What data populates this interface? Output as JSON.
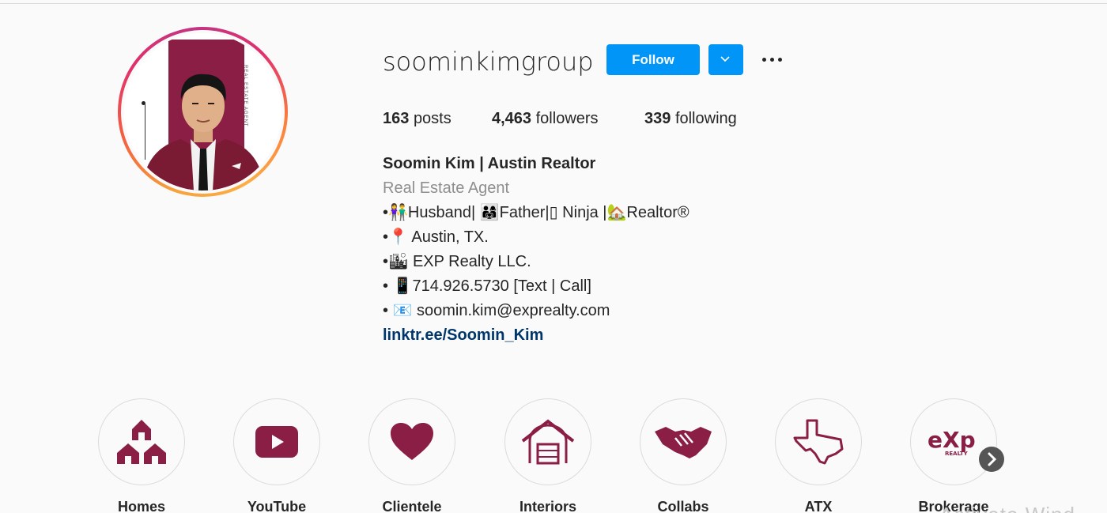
{
  "profile": {
    "username": "soominkimgroup",
    "follow_label": "Follow",
    "stats": {
      "posts_count": "163",
      "posts_label": "posts",
      "followers_count": "4,463",
      "followers_label": "followers",
      "following_count": "339",
      "following_label": "following"
    },
    "bio": {
      "name": "Soomin Kim | Austin Realtor",
      "category": "Real Estate Agent",
      "lines": [
        "•👫Husband| 👨‍👩‍👧Father|▯ Ninja |🏡Realtor®",
        "•📍 Austin, TX.",
        "•🏙 EXP Realty LLC.",
        "• 📱714.926.5730 [Text | Call]",
        "• 📧 soomin.kim@exprealty.com"
      ],
      "link": "linktr.ee/Soomin_Kim"
    },
    "avatar_text": "REAL ESTATE AGENT"
  },
  "highlights": [
    {
      "label": "Homes",
      "icon": "houses-icon"
    },
    {
      "label": "YouTube",
      "icon": "youtube-icon"
    },
    {
      "label": "Clientele",
      "icon": "heart-icon"
    },
    {
      "label": "Interiors",
      "icon": "garage-icon"
    },
    {
      "label": "Collabs",
      "icon": "handshake-icon"
    },
    {
      "label": "ATX",
      "icon": "texas-icon"
    },
    {
      "label": "Brokerage",
      "icon": "exp-logo-icon"
    }
  ],
  "colors": {
    "accent": "#0095f6",
    "brand": "#8a1e44",
    "link": "#00376b",
    "muted": "#8e8e8e"
  },
  "watermark_text": "Activate Wind"
}
